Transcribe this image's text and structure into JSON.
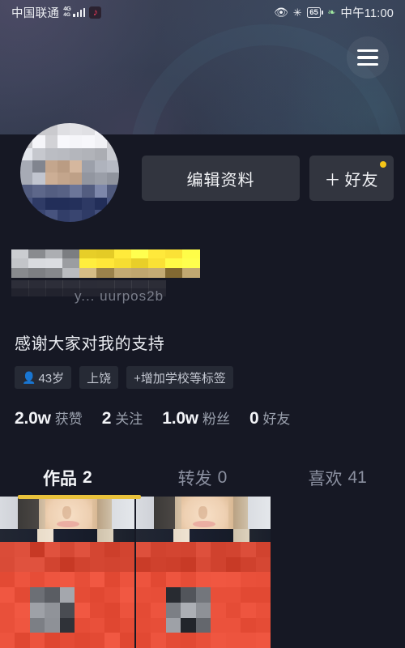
{
  "status_bar": {
    "carrier": "中国联通",
    "network_type_top": "4G",
    "network_type_bottom": "4G",
    "douyin_icon": "douyin-music-icon",
    "eye_icon": "eye-comfort-icon",
    "bluetooth_icon": "bluetooth-icon",
    "battery_level": "65",
    "power_save_icon": "leaf-power-save-icon",
    "clock": "中午11:00"
  },
  "header": {
    "menu_icon": "hamburger-menu-icon",
    "avatar": "user-avatar-censored"
  },
  "actions": {
    "edit_profile_label": "编辑资料",
    "add_friend_plus": "＋",
    "add_friend_label": "好友",
    "badge_color": "#f5c518"
  },
  "profile": {
    "nickname_censored": "user-nickname-censored",
    "douyin_id": "y... uurpos2b",
    "bio": "感谢大家对我的支持"
  },
  "tags": [
    {
      "icon": "person-icon",
      "label": "43岁"
    },
    {
      "icon": "",
      "label": "上饶"
    },
    {
      "icon": "",
      "label": "+增加学校等标签"
    }
  ],
  "stats": [
    {
      "value": "2.0w",
      "label": "获赞"
    },
    {
      "value": "2",
      "label": "关注"
    },
    {
      "value": "1.0w",
      "label": "粉丝"
    },
    {
      "value": "0",
      "label": "好友"
    }
  ],
  "tabs": [
    {
      "label": "作品",
      "count": "2",
      "active": true
    },
    {
      "label": "转发",
      "count": "0",
      "active": false
    },
    {
      "label": "喜欢",
      "count": "41",
      "active": false
    }
  ],
  "tab_underline_color": "#e9c23c",
  "grid": {
    "items": [
      {
        "name": "video-thumbnail-1"
      },
      {
        "name": "video-thumbnail-2"
      }
    ]
  }
}
